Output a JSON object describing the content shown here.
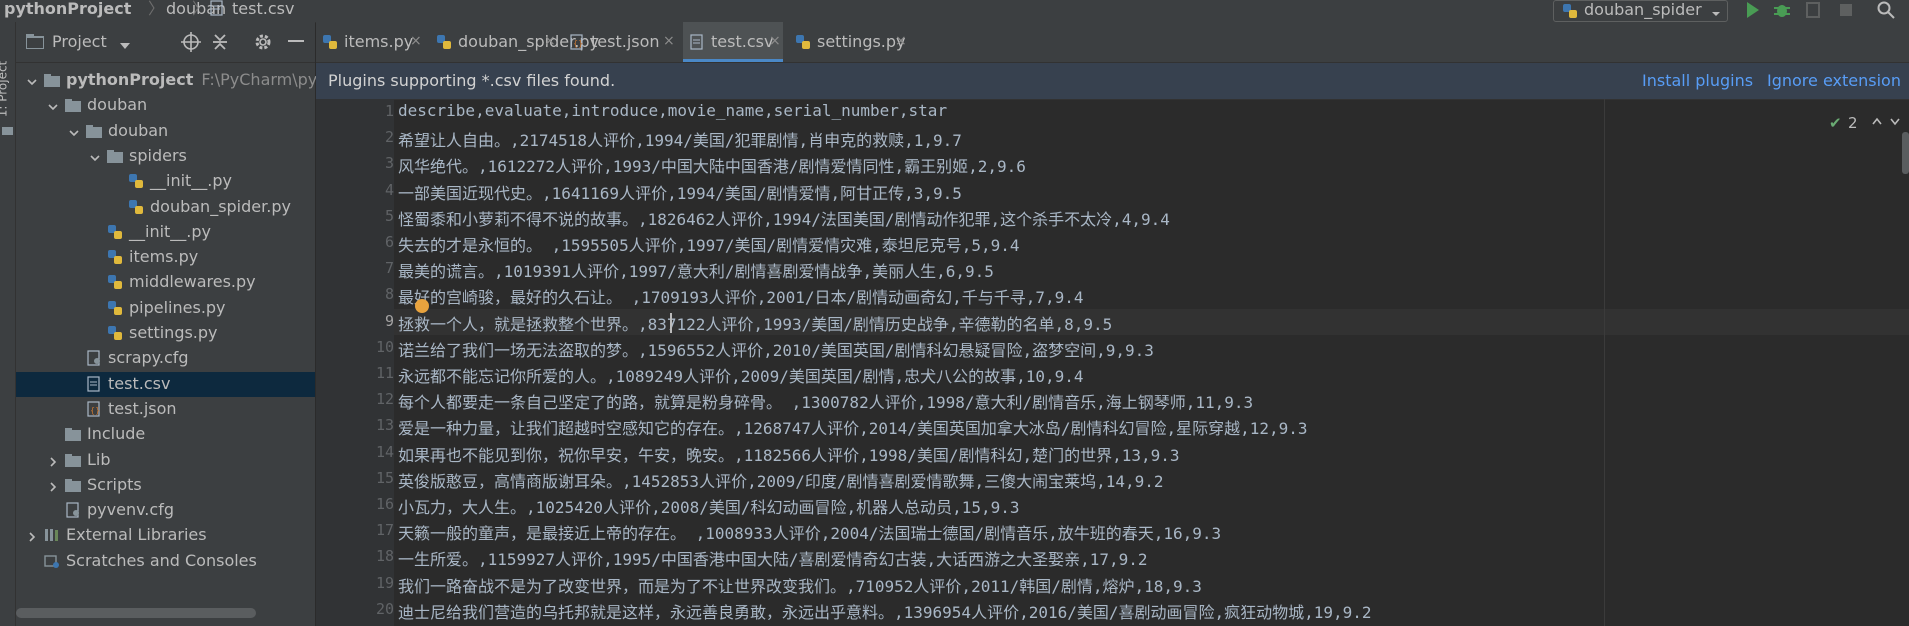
{
  "breadcrumbs": [
    "pythonProject",
    "douban",
    "test.csv"
  ],
  "run_config": "douban_spider",
  "colors": {
    "accent": "#4a88c7",
    "link": "#589df6",
    "bg": "#2b2b2b",
    "panel": "#3c3f41",
    "selection": "#0d293e"
  },
  "left_stripe": {
    "label": "1: Project"
  },
  "project_panel": {
    "title": "Project",
    "tree": [
      {
        "label": "pythonProject",
        "path": "F:\\PyCharm\\pytho",
        "type": "folder",
        "level": 0,
        "expanded": true
      },
      {
        "label": "douban",
        "type": "folder",
        "level": 1,
        "expanded": true
      },
      {
        "label": "douban",
        "type": "folder",
        "level": 2,
        "expanded": true
      },
      {
        "label": "spiders",
        "type": "folder",
        "level": 3,
        "expanded": true
      },
      {
        "label": "__init__.py",
        "type": "py",
        "level": 4
      },
      {
        "label": "douban_spider.py",
        "type": "py",
        "level": 4
      },
      {
        "label": "__init__.py",
        "type": "py",
        "level": 3
      },
      {
        "label": "items.py",
        "type": "py",
        "level": 3
      },
      {
        "label": "middlewares.py",
        "type": "py",
        "level": 3
      },
      {
        "label": "pipelines.py",
        "type": "py",
        "level": 3
      },
      {
        "label": "settings.py",
        "type": "py",
        "level": 3
      },
      {
        "label": "scrapy.cfg",
        "type": "cfg",
        "level": 2
      },
      {
        "label": "test.csv",
        "type": "csv",
        "level": 2,
        "selected": true
      },
      {
        "label": "test.json",
        "type": "json",
        "level": 2
      },
      {
        "label": "Include",
        "type": "folder",
        "level": 1
      },
      {
        "label": "Lib",
        "type": "folder",
        "level": 1,
        "collapsed": true
      },
      {
        "label": "Scripts",
        "type": "folder",
        "level": 1,
        "collapsed": true
      },
      {
        "label": "pyvenv.cfg",
        "type": "cfg",
        "level": 1
      },
      {
        "label": "External Libraries",
        "type": "lib",
        "level": 0,
        "collapsed": true
      },
      {
        "label": "Scratches and Consoles",
        "type": "scratch",
        "level": 0
      }
    ]
  },
  "tabs": [
    {
      "label": "items.py",
      "active": false
    },
    {
      "label": "douban_spider.py",
      "active": false
    },
    {
      "label": "test.json",
      "active": false
    },
    {
      "label": "test.csv",
      "active": true
    },
    {
      "label": "settings.py",
      "active": false
    }
  ],
  "banner": {
    "message": "Plugins supporting *.csv files found.",
    "install": "Install plugins",
    "ignore": "Ignore extension"
  },
  "inspection": {
    "count": "2"
  },
  "editor": {
    "current_line": 9,
    "lines": [
      "describe,evaluate,introduce,movie_name,serial_number,star",
      "希望让人自由。,2174518人评价,1994/美国/犯罪剧情,肖申克的救赎,1,9.7",
      "风华绝代。,1612272人评价,1993/中国大陆中国香港/剧情爱情同性,霸王别姬,2,9.6",
      "一部美国近现代史。,1641169人评价,1994/美国/剧情爱情,阿甘正传,3,9.5",
      "怪蜀黍和小萝莉不得不说的故事。,1826462人评价,1994/法国美国/剧情动作犯罪,这个杀手不太冷,4,9.4",
      "失去的才是永恒的。 ,1595505人评价,1997/美国/剧情爱情灾难,泰坦尼克号,5,9.4",
      "最美的谎言。,1019391人评价,1997/意大利/剧情喜剧爱情战争,美丽人生,6,9.5",
      "最好的宫崎骏，最好的久石让。 ,1709193人评价,2001/日本/剧情动画奇幻,千与千寻,7,9.4",
      "拯救一个人，就是拯救整个世界。,837122人评价,1993/美国/剧情历史战争,辛德勒的名单,8,9.5",
      "诺兰给了我们一场无法盗取的梦。,1596552人评价,2010/美国英国/剧情科幻悬疑冒险,盗梦空间,9,9.3",
      "永远都不能忘记你所爱的人。,1089249人评价,2009/美国英国/剧情,忠犬八公的故事,10,9.4",
      "每个人都要走一条自己坚定了的路，就算是粉身碎骨。 ,1300782人评价,1998/意大利/剧情音乐,海上钢琴师,11,9.3",
      "爱是一种力量，让我们超越时空感知它的存在。,1268747人评价,2014/美国英国加拿大冰岛/剧情科幻冒险,星际穿越,12,9.3",
      "如果再也不能见到你，祝你早安，午安，晚安。,1182566人评价,1998/美国/剧情科幻,楚门的世界,13,9.3",
      "英俊版憨豆，高情商版谢耳朵。,1452853人评价,2009/印度/剧情喜剧爱情歌舞,三傻大闹宝莱坞,14,9.2",
      "小瓦力，大人生。,1025420人评价,2008/美国/科幻动画冒险,机器人总动员,15,9.3",
      "天籁一般的童声，是最接近上帝的存在。 ,1008933人评价,2004/法国瑞士德国/剧情音乐,放牛班的春天,16,9.3",
      "一生所爱。,1159927人评价,1995/中国香港中国大陆/喜剧爱情奇幻古装,大话西游之大圣娶亲,17,9.2",
      "我们一路奋战不是为了改变世界，而是为了不让世界改变我们。,710952人评价,2011/韩国/剧情,熔炉,18,9.3",
      "迪士尼给我们营造的乌托邦就是这样，永远善良勇敢，永远出乎意料。,1396954人评价,2016/美国/喜剧动画冒险,疯狂动物城,19,9.2"
    ]
  }
}
